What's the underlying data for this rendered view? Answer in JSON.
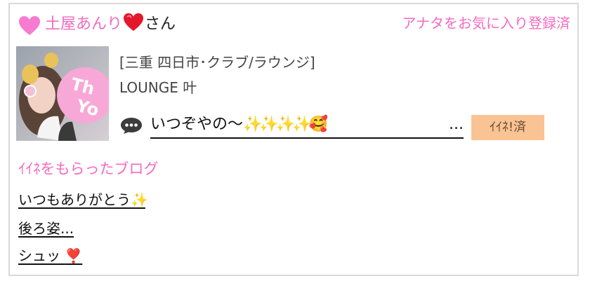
{
  "header": {
    "name": "土屋あんり",
    "name_heart": "❤️",
    "honorific": "さん",
    "favorite_status": "アナタをお気に入り登録済"
  },
  "shop": {
    "category": "[三重 四日市･クラブ/ラウンジ]",
    "name": "LOUNGE 叶"
  },
  "latest_post": {
    "title": "いつぞやの〜",
    "sparkles": "✨✨✨✨",
    "emoji": "🥰",
    "ellipsis": "...",
    "like_badge": "ｲｲﾈ!済"
  },
  "liked_blogs": {
    "heading": "ｲｲﾈをもらったブログ",
    "items": [
      {
        "title": "いつもありがとう",
        "emoji": "✨"
      },
      {
        "title": "後ろ姿...",
        "emoji": ""
      },
      {
        "title": "シュッ",
        "emoji": "❣️"
      }
    ]
  },
  "thumbnail_text": "Thank You",
  "colors": {
    "accent_pink": "#f56ac0",
    "badge_bg": "#f9c393",
    "border": "#d9d9d9"
  },
  "icons": {
    "header_heart": "pink-heart-icon",
    "comment": "speech-bubble-icon"
  }
}
